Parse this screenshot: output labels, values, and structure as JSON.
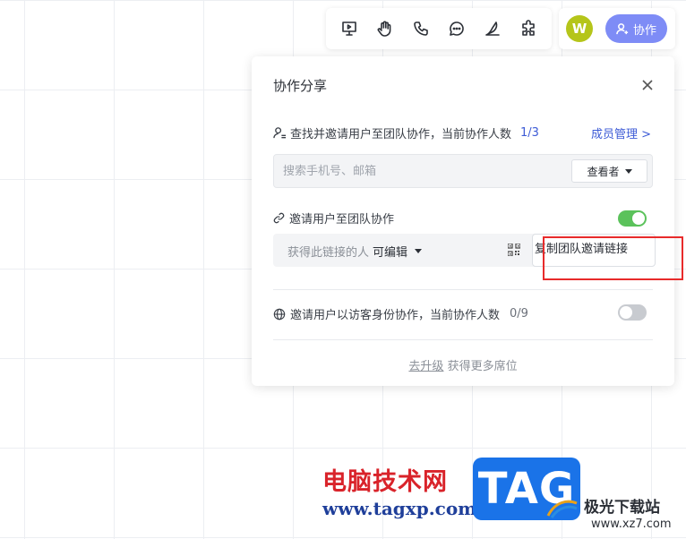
{
  "toolbar": {
    "icons": [
      "present-icon",
      "hand-icon",
      "phone-icon",
      "chat-icon",
      "pen-icon",
      "plugin-icon"
    ]
  },
  "user": {
    "avatar_initial": "W",
    "avatar_color": "#b5c51a",
    "collab_label": "协作",
    "collab_color": "#7e8cf6"
  },
  "panel": {
    "title": "协作分享",
    "invite_search": {
      "label": "查找并邀请用户至团队协作，当前协作人数",
      "count": "1/3",
      "member_link": "成员管理 >",
      "placeholder": "搜索手机号、邮箱",
      "role_value": "查看者"
    },
    "invite_link": {
      "label": "邀请用户至团队协作",
      "enabled": true,
      "link_prefix": "获得此链接的人",
      "permission": "可编辑",
      "copy_label": "复制团队邀请链接"
    },
    "guest": {
      "label": "邀请用户以访客身份协作，当前协作人数",
      "count": "0/9",
      "enabled": false
    },
    "upgrade": {
      "link": "去升级",
      "text": " 获得更多席位"
    }
  },
  "watermarks": {
    "left_title": "电脑技术网",
    "left_url": "www.tagxp.com",
    "tag": "TAG",
    "right_title": "极光下载站",
    "right_url": "www.xz7.com"
  },
  "colors": {
    "accent": "#3d5bd6",
    "toggle_on": "#5bc25b",
    "highlight": "#e82b2b"
  }
}
